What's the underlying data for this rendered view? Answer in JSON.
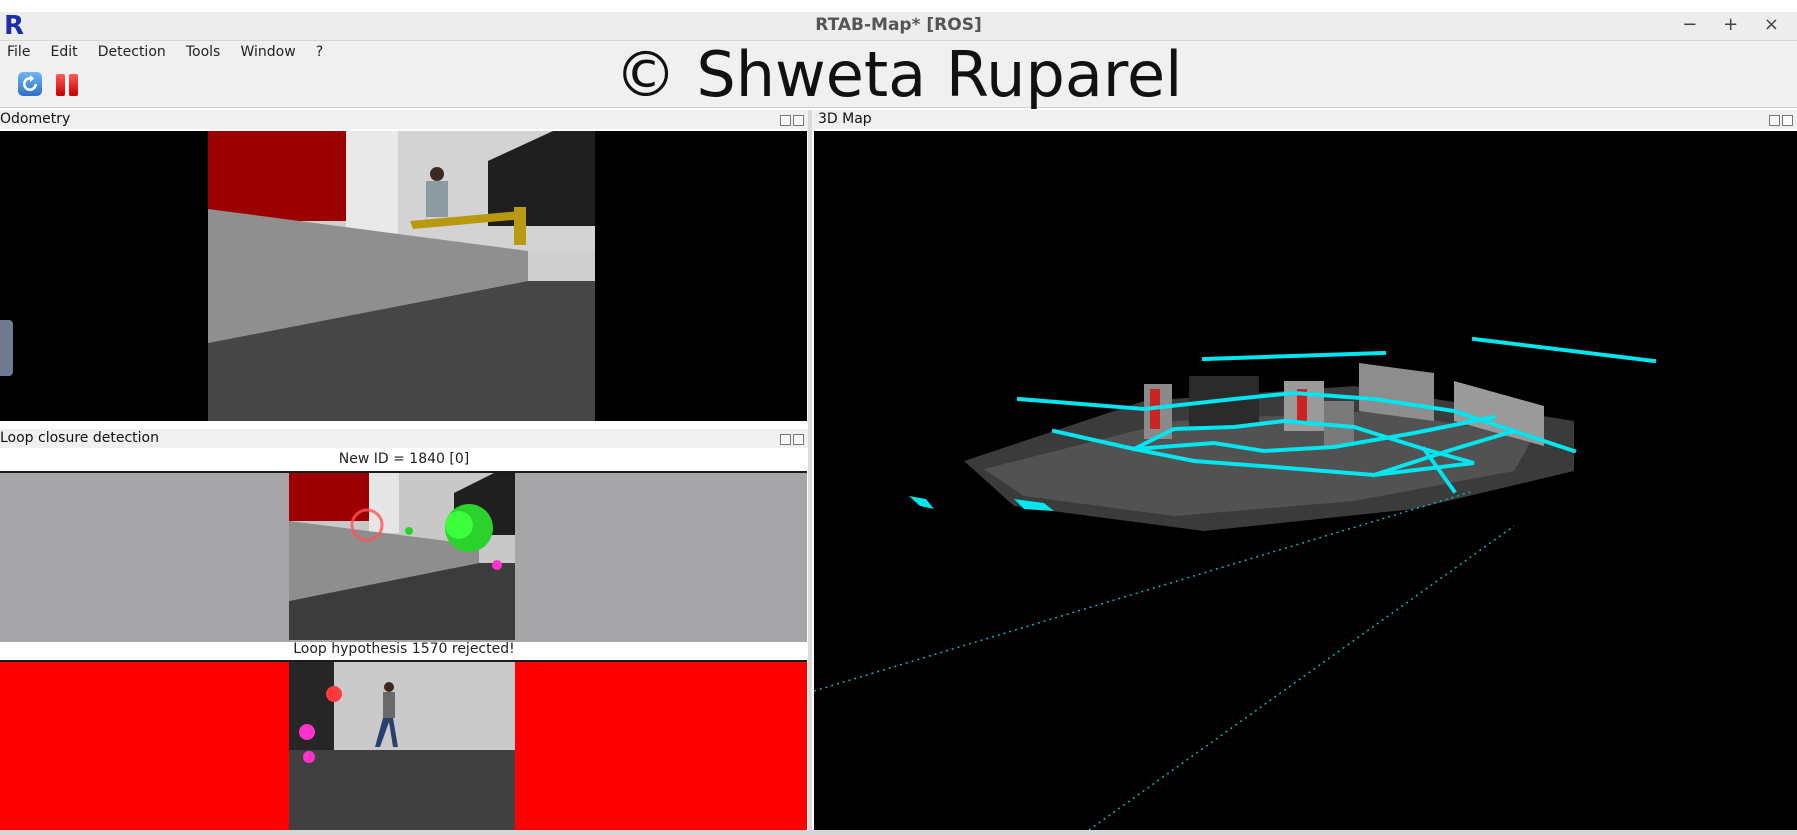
{
  "window": {
    "logo": "R",
    "title": "RTAB-Map* [ROS]",
    "controls": [
      "−",
      "+",
      "×"
    ]
  },
  "menubar": {
    "items": [
      "File",
      "Edit",
      "Detection",
      "Tools",
      "Window",
      "?"
    ]
  },
  "toolbar": {
    "icons": [
      "refresh-icon",
      "pause-icon"
    ]
  },
  "watermark": "© Shweta Ruparel",
  "panels": {
    "odometry": {
      "title": "Odometry"
    },
    "loop_closure": {
      "title": "Loop closure detection",
      "new_id_label": "New ID = 1840 [0]",
      "hypothesis_label": "Loop hypothesis 1570 rejected!"
    },
    "map3d": {
      "title": "3D Map"
    }
  },
  "colors": {
    "title_bar_bg": "#ededed",
    "logo_blue": "#1d2ea8",
    "map_graph_cyan": "#00e5ee",
    "rejected_red": "#ff0000",
    "viewport_bg": "#000000"
  }
}
